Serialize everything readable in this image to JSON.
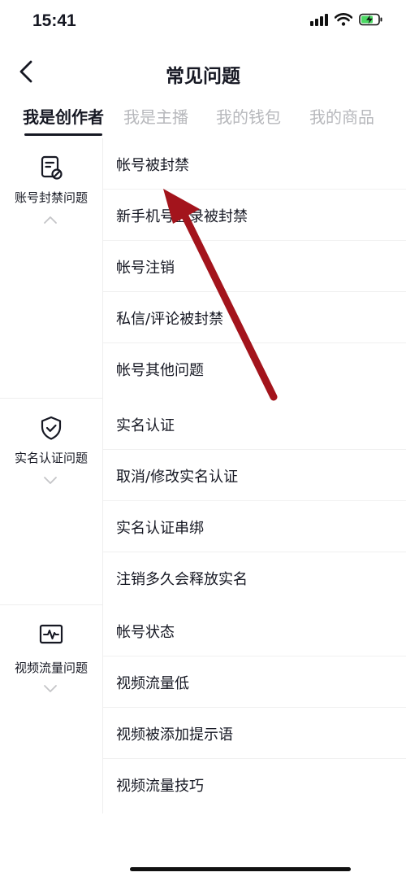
{
  "status_bar": {
    "time": "15:41"
  },
  "nav": {
    "title": "常见问题"
  },
  "tabs": [
    {
      "label": "我是创作者",
      "active": true
    },
    {
      "label": "我是主播",
      "active": false
    },
    {
      "label": "我的钱包",
      "active": false
    },
    {
      "label": "我的商品",
      "active": false
    }
  ],
  "sections": [
    {
      "category": "账号封禁问题",
      "icon": "document-ban-icon",
      "expanded": true,
      "items": [
        "帐号被封禁",
        "新手机号登录被封禁",
        "帐号注销",
        "私信/评论被封禁",
        "帐号其他问题"
      ]
    },
    {
      "category": "实名认证问题",
      "icon": "shield-check-icon",
      "expanded": false,
      "items": [
        "实名认证",
        "取消/修改实名认证",
        "实名认证串绑",
        "注销多久会释放实名"
      ]
    },
    {
      "category": "视频流量问题",
      "icon": "pulse-monitor-icon",
      "expanded": false,
      "items": [
        "帐号状态",
        "视频流量低",
        "视频被添加提示语",
        "视频流量技巧"
      ]
    }
  ],
  "annotation_arrow_color": "#a3141c"
}
